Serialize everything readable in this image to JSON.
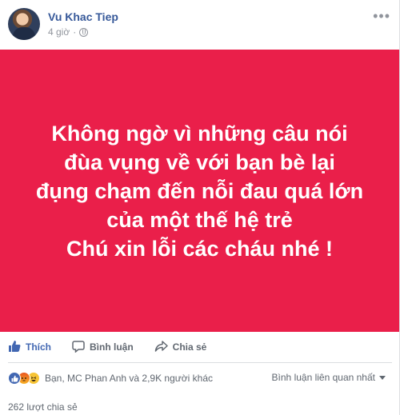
{
  "post": {
    "author": "Vu Khac Tiep",
    "time": "4 giờ",
    "text_lines": [
      "Không ngờ vì những câu nói",
      "đùa vụng về với bạn bè lại",
      "đụng chạm đến nỗi đau quá lớn",
      "của một thế hệ trẻ",
      "Chú xin lỗi các cháu nhé !"
    ],
    "background_color": "#ea1f4a"
  },
  "actions": {
    "like_label": "Thích",
    "comment_label": "Bình luận",
    "share_label": "Chia sẻ"
  },
  "reactions": {
    "icons": [
      "like-icon",
      "angry-icon",
      "haha-icon"
    ],
    "summary": "Bạn, MC Phan Anh và 2,9K người khác"
  },
  "comments": {
    "sort_label": "Bình luận liên quan nhất"
  },
  "shares": {
    "count_text": "262 lượt chia sẻ"
  },
  "colors": {
    "author_link": "#365899",
    "like_active": "#4267b2"
  }
}
